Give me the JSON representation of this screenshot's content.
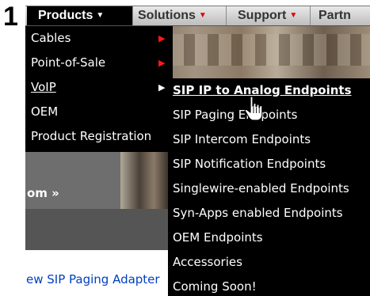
{
  "step_number": "1",
  "navbar": {
    "items": [
      {
        "label": "Products"
      },
      {
        "label": "Solutions"
      },
      {
        "label": "Support"
      },
      {
        "label": "Partn"
      }
    ]
  },
  "products_menu": {
    "items": [
      {
        "label": "Cables"
      },
      {
        "label": "Point-of-Sale"
      },
      {
        "label": "VoIP"
      },
      {
        "label": "OEM"
      },
      {
        "label": "Product Registration"
      }
    ]
  },
  "voip_menu": {
    "items": [
      {
        "label": "SIP IP to Analog Endpoints"
      },
      {
        "label": "SIP Paging Endpoints"
      },
      {
        "label": "SIP Intercom Endpoints"
      },
      {
        "label": "SIP Notification Endpoints"
      },
      {
        "label": "Singlewire-enabled Endpoints"
      },
      {
        "label": "Syn-Apps enabled Endpoints"
      },
      {
        "label": "OEM Endpoints"
      },
      {
        "label": "Accessories"
      },
      {
        "label": "Coming Soon!"
      }
    ]
  },
  "page": {
    "more_link": "om »",
    "news_link": "ew SIP Paging Adapter"
  },
  "icons": {
    "dropdown_caret": "caret-down-icon",
    "submenu_arrow": "caret-right-icon",
    "cursor": "hand-pointer-icon"
  },
  "colors": {
    "menu_bg": "#000000",
    "accent_red": "#ff1a1a",
    "link_blue": "#0040c0"
  }
}
